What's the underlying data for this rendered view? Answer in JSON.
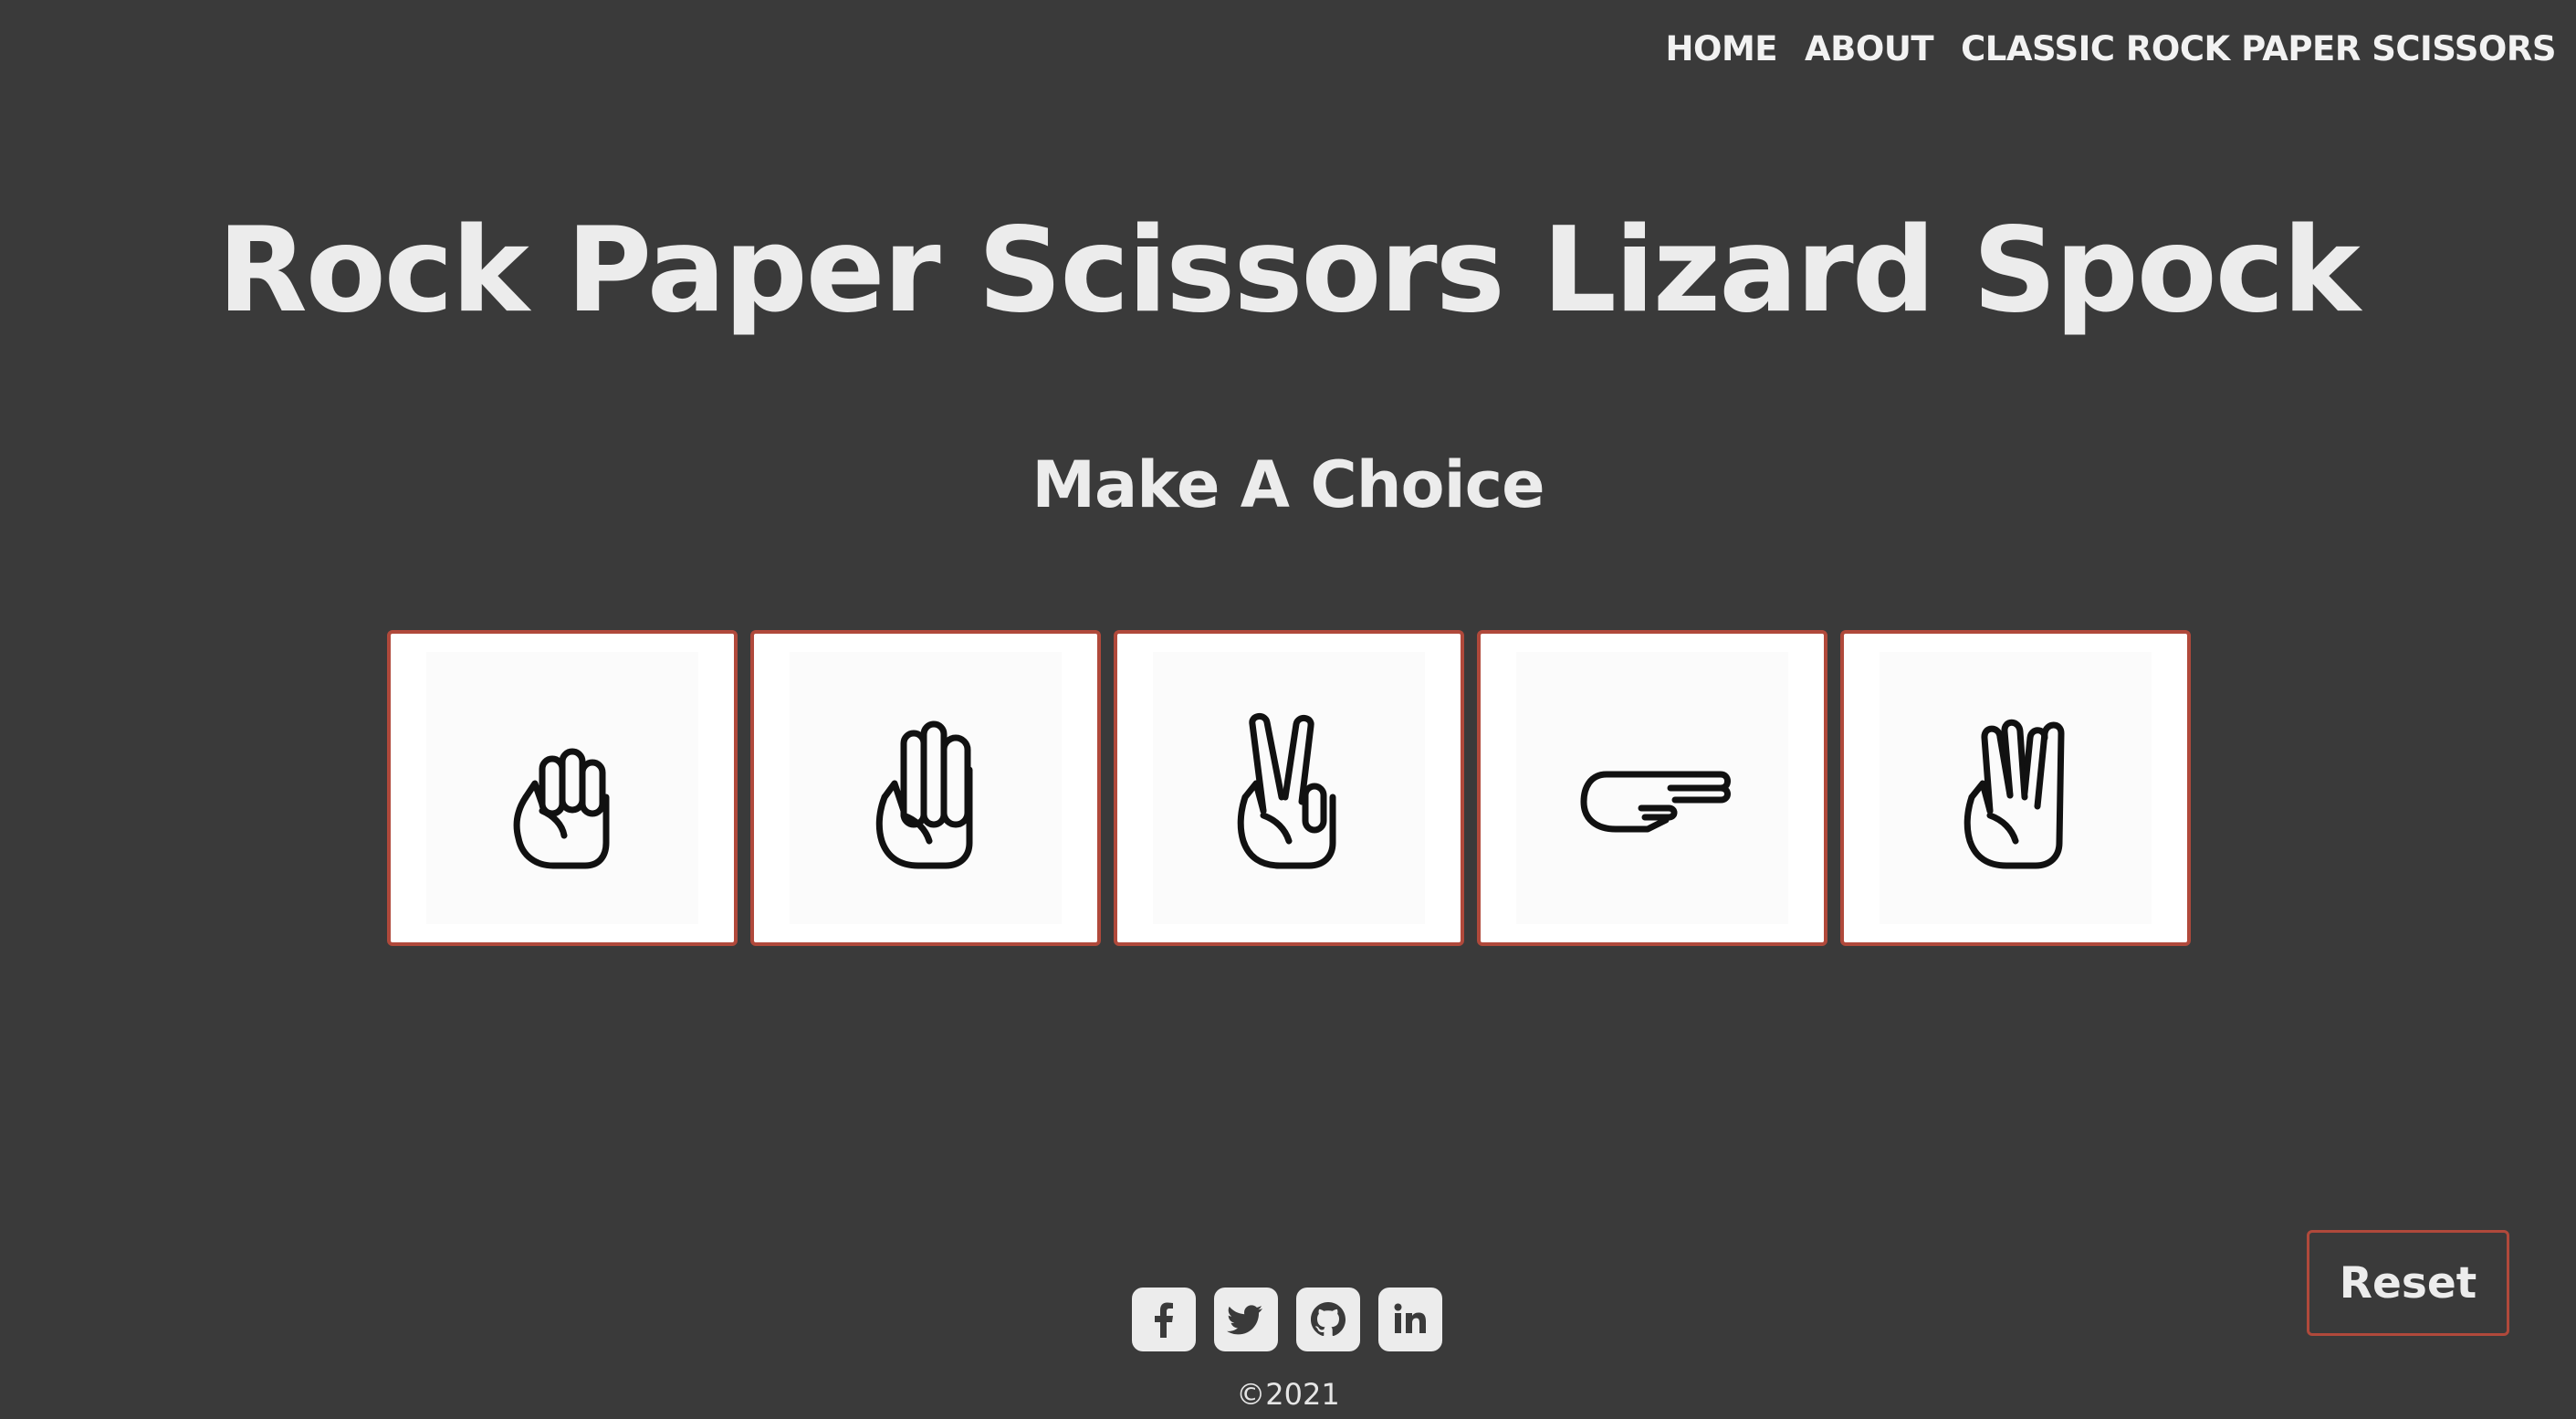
{
  "nav": {
    "items": [
      {
        "label": "HOME"
      },
      {
        "label": "ABOUT"
      },
      {
        "label": "CLASSIC ROCK PAPER SCISSORS"
      }
    ]
  },
  "header": {
    "title": "Rock Paper Scissors Lizard Spock",
    "subtitle": "Make A Choice"
  },
  "choices": [
    {
      "name": "rock",
      "icon": "rock-hand-icon"
    },
    {
      "name": "paper",
      "icon": "paper-hand-icon"
    },
    {
      "name": "scissors",
      "icon": "scissors-hand-icon"
    },
    {
      "name": "lizard",
      "icon": "lizard-hand-icon"
    },
    {
      "name": "spock",
      "icon": "spock-hand-icon"
    }
  ],
  "footer": {
    "social": [
      "facebook-icon",
      "twitter-icon",
      "github-icon",
      "linkedin-icon"
    ],
    "copyright": "©2021"
  },
  "actions": {
    "reset_label": "Reset"
  },
  "colors": {
    "background": "#3a3a3a",
    "text": "#ececec",
    "accent_border": "#b0493b",
    "card_bg": "#ffffff"
  }
}
